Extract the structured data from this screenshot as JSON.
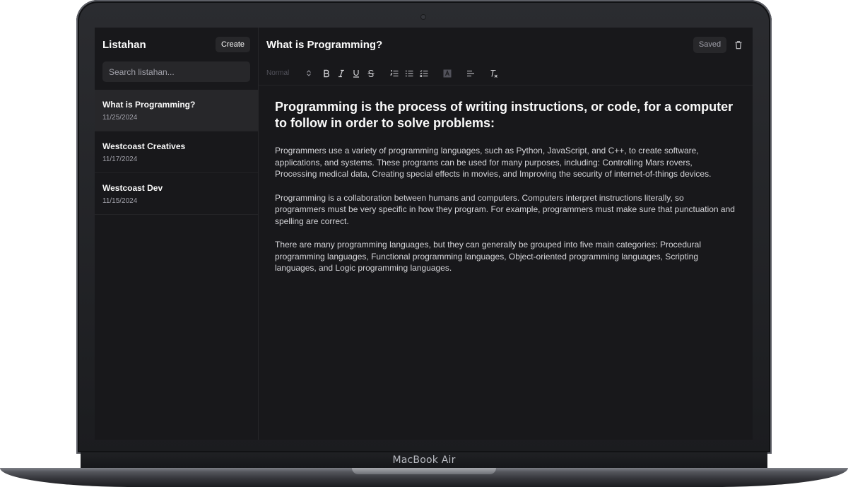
{
  "device": {
    "brand_label": "MacBook Air"
  },
  "sidebar": {
    "title": "Listahan",
    "create_label": "Create",
    "search_placeholder": "Search listahan...",
    "notes": [
      {
        "title": "What is Programming?",
        "date": "11/25/2024"
      },
      {
        "title": "Westcoast Creatives",
        "date": "11/17/2024"
      },
      {
        "title": "Westcoast Dev",
        "date": "11/15/2024"
      }
    ]
  },
  "editor": {
    "title": "What is Programming?",
    "saved_label": "Saved",
    "toolbar": {
      "format_value": "Normal",
      "tools": [
        "bold-icon",
        "italic-icon",
        "underline-icon",
        "strikethrough-icon",
        "ordered-list-icon",
        "bullet-list-icon",
        "checklist-icon",
        "text-color-icon",
        "align-icon",
        "clear-format-icon"
      ]
    },
    "heading": "Programming is the process of writing instructions, or code, for a computer to follow in order to solve problems:",
    "paragraphs": [
      "Programmers use a variety of programming languages, such as Python, JavaScript, and C++, to create software, applications, and systems. These programs can be used for many purposes, including: Controlling Mars rovers, Processing medical data, Creating special effects in movies, and Improving the security of internet-of-things devices.",
      "Programming is a collaboration between humans and computers. Computers interpret instructions literally, so programmers must be very specific in how they program. For example, programmers must make sure that punctuation and spelling are correct.",
      "There are many programming languages, but they can generally be grouped into five main categories: Procedural programming languages, Functional programming languages, Object-oriented programming languages, Scripting languages, and Logic programming languages."
    ]
  },
  "colors": {
    "background": "#18181b",
    "surface": "#27272a",
    "text": "#fafafa",
    "muted": "#a1a1aa"
  }
}
